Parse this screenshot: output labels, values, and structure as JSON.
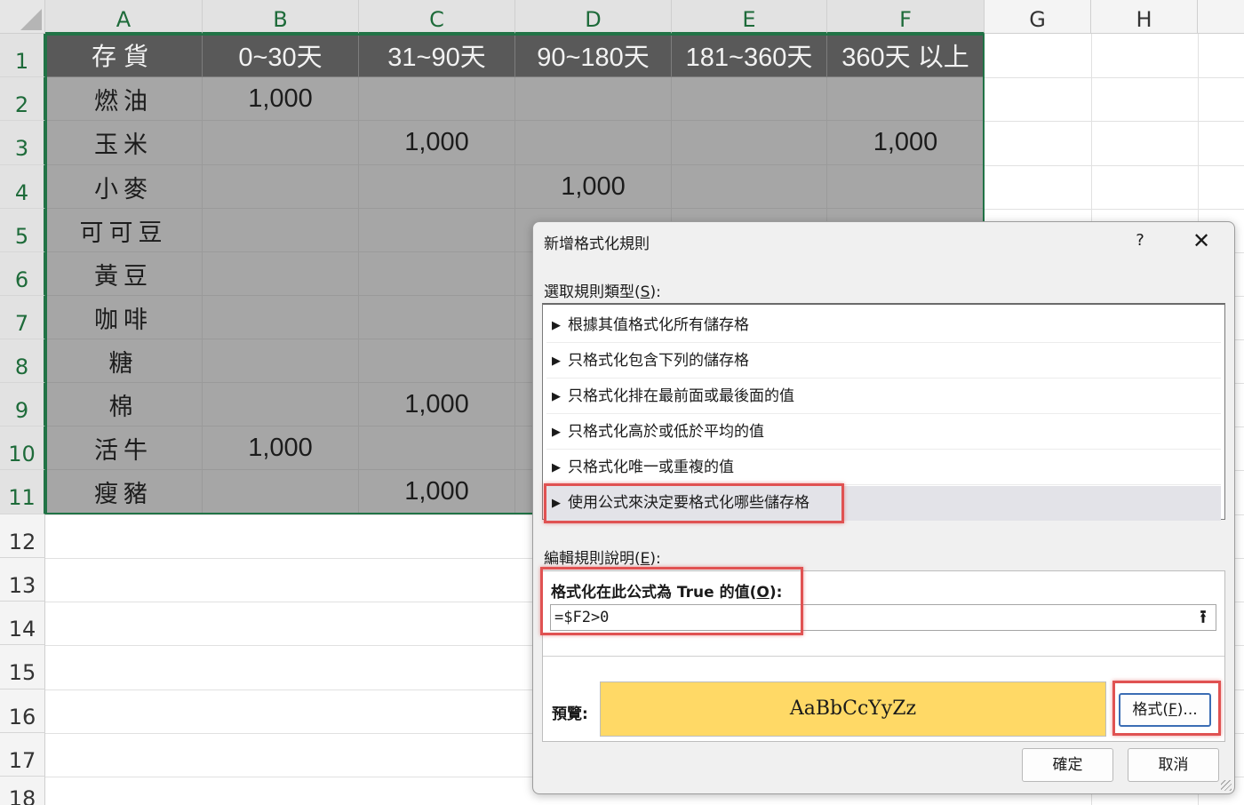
{
  "columns": [
    "A",
    "B",
    "C",
    "D",
    "E",
    "F",
    "G",
    "H"
  ],
  "rows": [
    "1",
    "2",
    "3",
    "4",
    "5",
    "6",
    "7",
    "8",
    "9",
    "10",
    "11",
    "12",
    "13",
    "14",
    "15",
    "16",
    "17",
    "18"
  ],
  "table": {
    "headers": [
      "存貨",
      "0~30天",
      "31~90天",
      "90~180天",
      "181~360天",
      "360天 以上"
    ],
    "rows": [
      [
        "燃油",
        "1,000",
        "",
        "",
        "",
        ""
      ],
      [
        "玉米",
        "",
        "1,000",
        "",
        "",
        "1,000"
      ],
      [
        "小麥",
        "",
        "",
        "1,000",
        "",
        ""
      ],
      [
        "可可豆",
        "",
        "",
        "",
        "",
        ""
      ],
      [
        "黃豆",
        "",
        "",
        "",
        "",
        ""
      ],
      [
        "咖啡",
        "",
        "",
        "",
        "",
        ""
      ],
      [
        "糖",
        "",
        "",
        "",
        "",
        ""
      ],
      [
        "棉",
        "",
        "1,000",
        "",
        "",
        ""
      ],
      [
        "活牛",
        "1,000",
        "",
        "",
        "",
        ""
      ],
      [
        "瘦豬",
        "",
        "1,000",
        "",
        "",
        ""
      ]
    ]
  },
  "dialog": {
    "title": "新增格式化規則",
    "help": "?",
    "close": "✕",
    "rule_type_label": "選取規則類型(",
    "rule_type_key": "S",
    "rule_type_suffix": "):",
    "rule_types": [
      "根據其值格式化所有儲存格",
      "只格式化包含下列的儲存格",
      "只格式化排在最前面或最後面的值",
      "只格式化高於或低於平均的值",
      "只格式化唯一或重複的值",
      "使用公式來決定要格式化哪些儲存格"
    ],
    "selected_rule_index": 5,
    "edit_label": "編輯規則說明(",
    "edit_key": "E",
    "edit_suffix": "):",
    "formula_label": "格式化在此公式為 True 的值(",
    "formula_key": "O",
    "formula_suffix": "):",
    "formula_value": "=$F2>0",
    "preview_label": "預覽:",
    "preview_text": "AaBbCcYyZz",
    "preview_color": "#ffd966",
    "format_button": "格式(",
    "format_key": "F",
    "format_suffix": ")...",
    "ok_button": "確定",
    "cancel_button": "取消"
  },
  "icons": {
    "triangle": "▶",
    "collapse": "⭱"
  },
  "colors": {
    "header_fill": "#595959",
    "body_fill": "#a6a6a6",
    "selection_border": "#217346",
    "highlight_box": "#e05252"
  }
}
